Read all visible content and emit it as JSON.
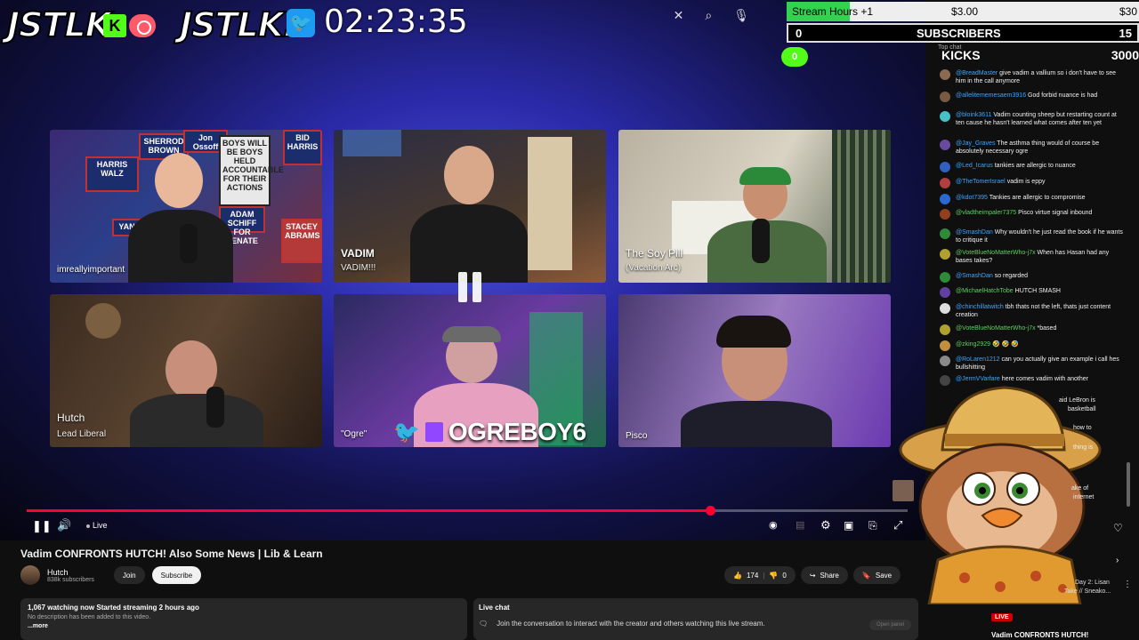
{
  "overlay": {
    "brand_left": "JSTLK",
    "brand_right": "JSTLK.",
    "kick_letter": "K",
    "clock": "02:23:35",
    "goal": {
      "label": "Stream Hours +1",
      "min": "$3.00",
      "max": "$30",
      "progress": 0.18,
      "color": "#33d14f"
    },
    "subscribers": {
      "current": "0",
      "label": "SUBSCRIBERS",
      "goal": "15"
    },
    "kicks": {
      "current": "0",
      "label": "KICKS",
      "goal": "3000"
    }
  },
  "player": {
    "tiles": [
      {
        "name": "imreallyimportant",
        "sub": ""
      },
      {
        "name": "VADIM",
        "sub": "VADIM!!!"
      },
      {
        "name": "The Soy Pill",
        "sub": "(Vacation Arc)"
      },
      {
        "name": "Hutch",
        "sub": "Lead Liberal"
      },
      {
        "name": "\"Ogre\"",
        "sub": ""
      },
      {
        "name": "Pisco",
        "sub": ""
      }
    ],
    "posters": [
      "HARRIS WALZ",
      "SHERROD BROWN",
      "Jon Ossoff",
      "BOYS WILL BE BOYS HELD ACCOUNTABLE FOR THEIR ACTIONS",
      "BID HARRIS",
      "ADAM SCHIFF FOR SENATE",
      "STACEY ABRAMS",
      "YANG"
    ],
    "ogre_handle": "OGREBOY6",
    "progress": 0.776,
    "live_label": "Live",
    "accent": "#ff0033"
  },
  "video": {
    "title": "Vadim CONFRONTS HUTCH! Also Some News | Lib & Learn",
    "channel_name": "Hutch",
    "channel_subs": "838k subscribers",
    "join_label": "Join",
    "subscribe_label": "Subscribe",
    "likes": "174",
    "dislikes": "0",
    "share_label": "Share",
    "save_label": "Save",
    "stats": "1,067 watching now  Started streaming 2 hours ago",
    "description": "No description has been added to this video.",
    "more_label": "...more",
    "live_chat_title": "Live chat",
    "live_chat_msg": "Join the conversation to interact with the creator and others watching this live stream.",
    "open_panel": "Open panel"
  },
  "chat": {
    "header": "Top chat",
    "messages": [
      {
        "user": "@BreadMaster",
        "msg": "give vadim a vallium so i don't have to see him in the call anymore",
        "av": "#8a6a50"
      },
      {
        "user": "@allelitememesaem3916",
        "msg": "God forbid nuance is had",
        "av": "#7a5a40"
      },
      {
        "user": "@bloink3611",
        "msg": "Vadim counting sheep but restarting count at ten cause he hasn't learned what comes after ten yet",
        "av": "#46c1c9"
      },
      {
        "user": "@Jay_Graves",
        "msg": "The asthma thing would of course be absolutely necessary ogre",
        "av": "#6a4aa0"
      },
      {
        "user": "@Led_Icarus",
        "msg": "tankies are allergic to nuance",
        "av": "#3060c0"
      },
      {
        "user": "@TheTomerIsrael",
        "msg": "vadim is eppy",
        "av": "#b04040"
      },
      {
        "user": "@kdot7395",
        "msg": "Tankies are allergic to compromise",
        "av": "#2a6ad0"
      },
      {
        "user": "@vladtheimpaler7375",
        "msg": "Pisco virtue signal inbound",
        "av": "#904020",
        "green": true
      },
      {
        "user": "@SmashDan",
        "msg": "Why wouldn't he just read the book if he wants to critique it",
        "av": "#2f8a3a"
      },
      {
        "user": "@VoteBlueNoMatterWho-j7x",
        "msg": "When has Hasan had any bases takes?",
        "av": "#b0a030",
        "green": true
      },
      {
        "user": "@SmashDan",
        "msg": "so regarded",
        "av": "#2f8a3a"
      },
      {
        "user": "@MichaelHatchTobe",
        "msg": "HUTCH SMASH",
        "av": "#6040a0",
        "green": true
      },
      {
        "user": "@chinchillatwitch",
        "msg": "tbh thats not the left, thats just content creation",
        "av": "#dddddd"
      },
      {
        "user": "@VoteBlueNoMatterWho-j7x",
        "msg": "*based",
        "av": "#b0a030",
        "green": true
      },
      {
        "user": "@zking2929",
        "msg": "🤣 🤣 🤣",
        "av": "#c09040",
        "green": true
      },
      {
        "user": "@RoLaren1212",
        "msg": "can you actually give an example i call hes bullshitting",
        "av": "#8a8a8a"
      },
      {
        "user": "@JermVVarfare",
        "msg": "here comes vadim with another",
        "av": "#444444"
      }
    ],
    "fragments": [
      "aid LeBron is",
      "basketball",
      "how to",
      "thing is",
      "ake of",
      "internet"
    ],
    "side_text_1": "Day 2: Lisan",
    "side_text_2": "Take // Sneako...",
    "live_badge": "LIVE",
    "next_title": "Vadim CONFRONTS HUTCH!"
  }
}
